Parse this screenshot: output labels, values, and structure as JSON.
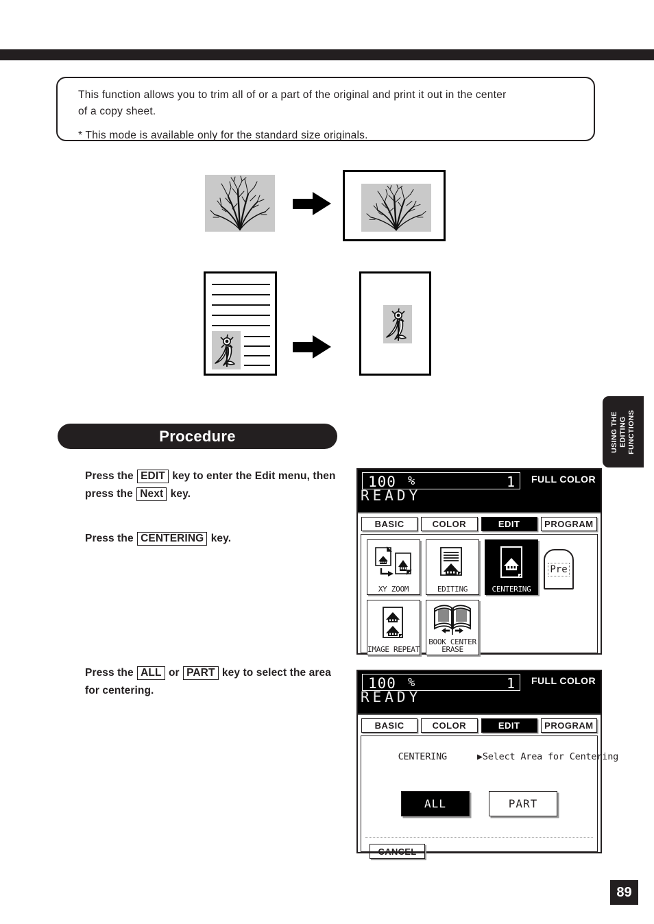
{
  "document": {
    "page_number": "89",
    "side_tab_label": "USING THE\nEDITING\nFUNCTIONS"
  },
  "description": {
    "line1": "This function allows you to trim all of or a part of the original and print it out in the center",
    "line2": "of a copy sheet.",
    "note": "* This mode is available only for the standard size originals."
  },
  "procedure": {
    "heading": "Procedure",
    "steps": [
      {
        "id": "step-1",
        "parts": [
          {
            "t": "Press the ",
            "key": false
          },
          {
            "t": "EDIT",
            "key": true
          },
          {
            "t": " key to enter the Edit menu, then press the ",
            "key": false
          },
          {
            "t": "Next",
            "key": true
          },
          {
            "t": " key.",
            "key": false
          }
        ]
      },
      {
        "id": "step-2",
        "parts": [
          {
            "t": "Press the ",
            "key": false
          },
          {
            "t": "CENTERING",
            "key": true
          },
          {
            "t": " key.",
            "key": false
          }
        ]
      },
      {
        "id": "step-3",
        "parts": [
          {
            "t": "Press the ",
            "key": false
          },
          {
            "t": "ALL",
            "key": true
          },
          {
            "t": " or ",
            "key": false
          },
          {
            "t": "PART",
            "key": true
          },
          {
            "t": " key to select the area for centering.",
            "key": false
          }
        ]
      }
    ]
  },
  "lcd_panel_1": {
    "status": {
      "ratio": "100",
      "percent": "%",
      "copies": "1",
      "color_mode": "FULL COLOR",
      "message": "READY"
    },
    "tabs": [
      {
        "label": "BASIC",
        "selected": false
      },
      {
        "label": "COLOR",
        "selected": false
      },
      {
        "label": "EDIT",
        "selected": true
      },
      {
        "label": "PROGRAM",
        "selected": false
      }
    ],
    "functions": [
      {
        "label": "XY ZOOM",
        "icon": "xy-zoom-icon",
        "selected": false
      },
      {
        "label": "EDITING",
        "icon": "editing-icon",
        "selected": false
      },
      {
        "label": "CENTERING",
        "icon": "centering-icon",
        "selected": true
      },
      {
        "label": "IMAGE REPEAT",
        "icon": "image-repeat-icon",
        "selected": false
      },
      {
        "label": "BOOK CENTER\nERASE",
        "icon": "book-center-erase-icon",
        "selected": false
      }
    ],
    "prev_tab_label": "Pre"
  },
  "lcd_panel_2": {
    "status": {
      "ratio": "100",
      "percent": "%",
      "copies": "1",
      "color_mode": "FULL COLOR",
      "message": "READY"
    },
    "tabs": [
      {
        "label": "BASIC",
        "selected": false
      },
      {
        "label": "COLOR",
        "selected": false
      },
      {
        "label": "EDIT",
        "selected": true
      },
      {
        "label": "PROGRAM",
        "selected": false
      }
    ],
    "breadcrumb_mode": "CENTERING",
    "breadcrumb_prompt": "▶Select Area for Centering",
    "choices": [
      {
        "label": "ALL",
        "selected": true
      },
      {
        "label": "PART",
        "selected": false
      }
    ],
    "cancel_label": "CANCEL"
  },
  "illustrations": {
    "row1": {
      "source_alt": "bush-artwork-original",
      "result_alt": "bush-artwork-centered-on-sheet",
      "arrow": "right-arrow-icon"
    },
    "row2": {
      "source_alt": "lined-document-with-flower-region",
      "result_alt": "flower-region-centered-on-sheet",
      "arrow": "right-arrow-icon"
    }
  },
  "colors": {
    "ink": "#231f20",
    "art_gray": "#c9c9c9",
    "panel_black": "#000000"
  }
}
